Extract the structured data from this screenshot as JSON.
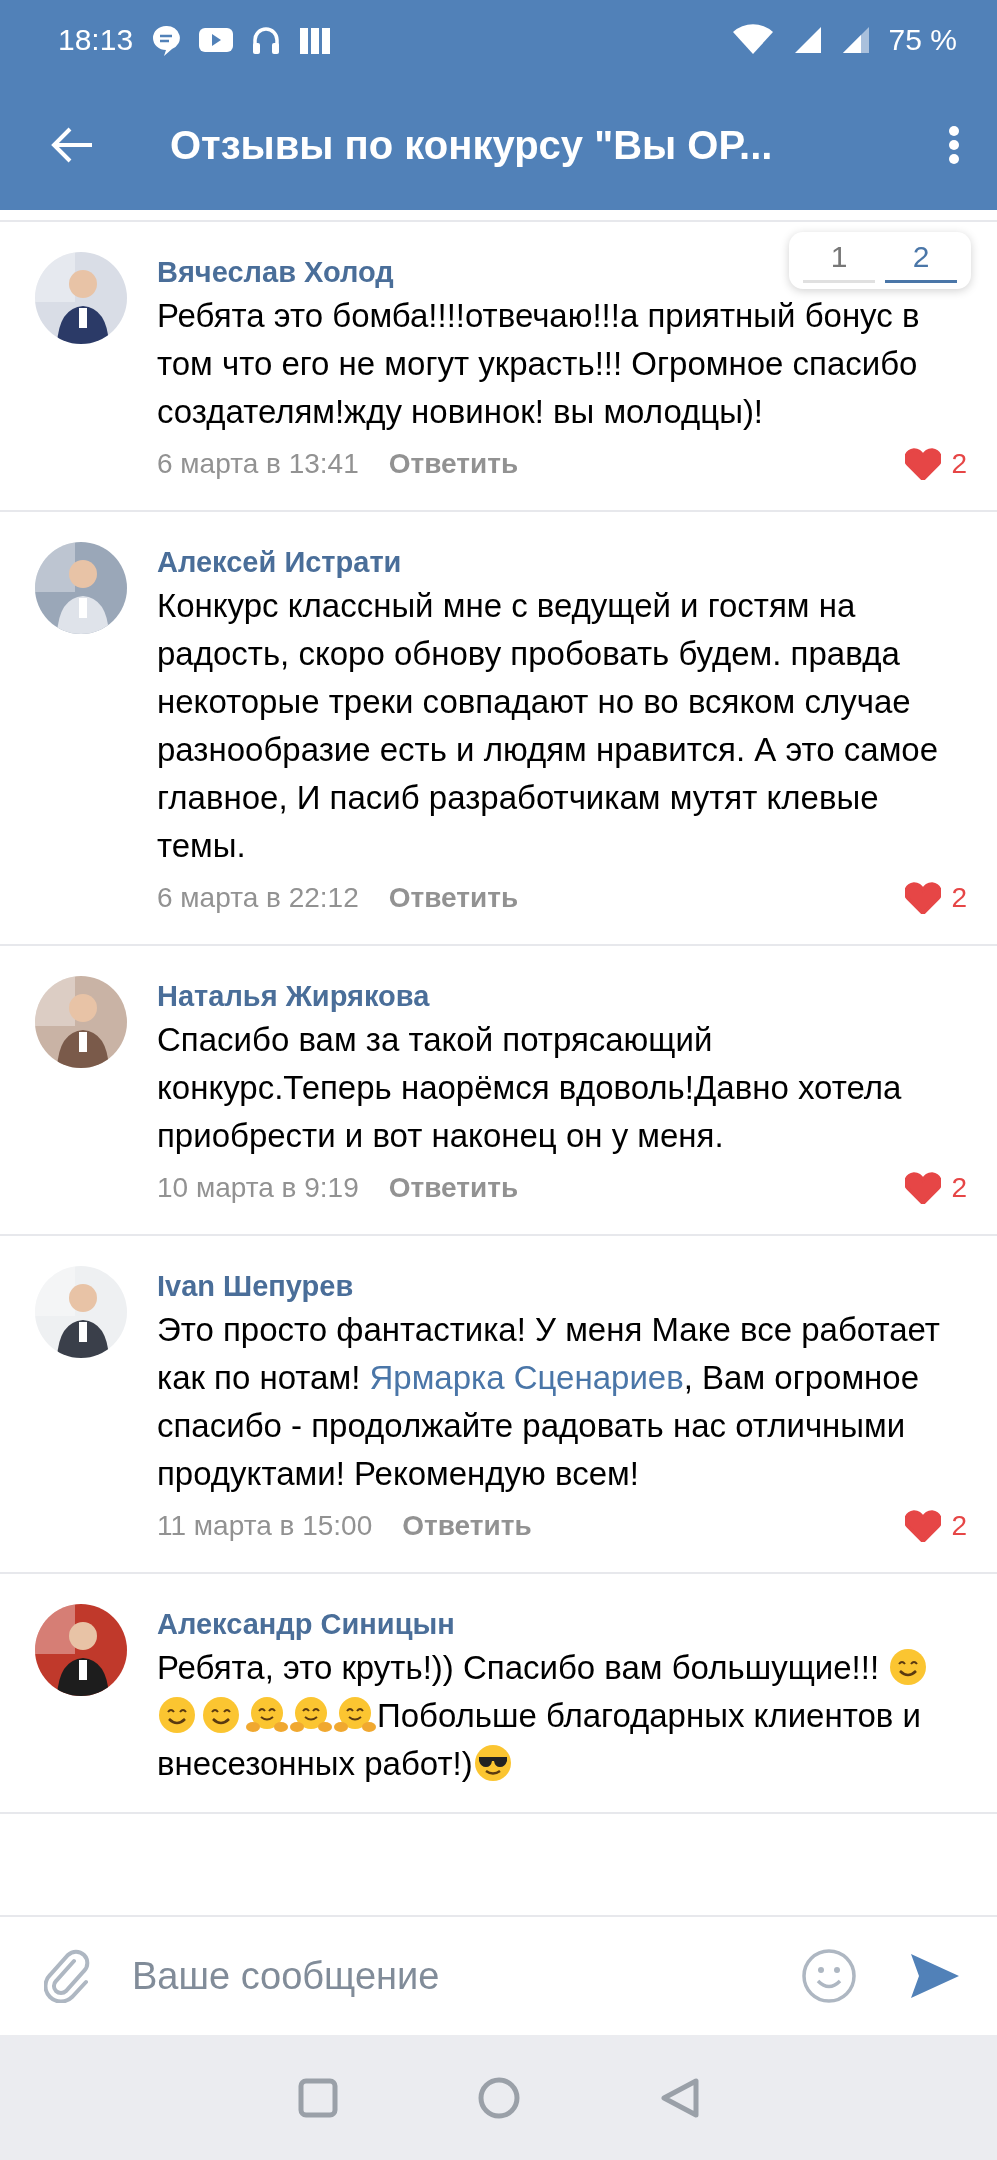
{
  "status_bar": {
    "time": "18:13",
    "battery": "75 %"
  },
  "header": {
    "title": "Отзывы по конкурсу \"Вы ОР..."
  },
  "pagination": [
    {
      "label": "1",
      "selected": false
    },
    {
      "label": "2",
      "selected": true
    }
  ],
  "comments": [
    {
      "author": "Вячеслав Холод",
      "body": [
        {
          "kind": "text",
          "text": "Ребята это бомба!!!!отвечаю!!!а приятный бонус в том что его не могут украсть!!! Огромное спасибо создателям!жду новинок! вы молодцы)!"
        }
      ],
      "date": "6 марта в 13:41",
      "reply": "Ответить",
      "likes": "2",
      "liked": true
    },
    {
      "author": "Алексей Истрати",
      "body": [
        {
          "kind": "text",
          "text": "Конкурс классный мне с ведущей и гостям на радость, скоро обнову пробовать будем. правда некоторые треки совпадают но во всяком случае разнообразие есть и людям нравится. А это самое главное, И пасиб разработчикам мутят клевые темы."
        }
      ],
      "date": "6 марта в 22:12",
      "reply": "Ответить",
      "likes": "2",
      "liked": true
    },
    {
      "author": "Наталья Жирякова",
      "body": [
        {
          "kind": "text",
          "text": "Спасибо вам за такой потрясающий конкурс.Теперь наорёмся вдоволь!Давно хотела приобрести и вот наконец он у меня."
        }
      ],
      "date": "10 марта в 9:19",
      "reply": "Ответить",
      "likes": "2",
      "liked": true
    },
    {
      "author": "Ivan Шепурев",
      "body": [
        {
          "kind": "text",
          "text": "Это просто фантастика! У меня Маке все работает как по нотам! "
        },
        {
          "kind": "link",
          "text": "Ярмарка Сценариев"
        },
        {
          "kind": "text",
          "text": ", Вам огромное спасибо - продолжайте радовать нас отличными продуктами! Рекомендую всем!"
        }
      ],
      "date": "11 марта в 15:00",
      "reply": "Ответить",
      "likes": "2",
      "liked": true
    },
    {
      "author": "Александр Синицын",
      "body": [
        {
          "kind": "text",
          "text": "Ребята, это круть!)) Спасибо вам большущие!!! "
        },
        {
          "kind": "smile"
        },
        {
          "kind": "smile"
        },
        {
          "kind": "smile"
        },
        {
          "kind": "hug"
        },
        {
          "kind": "hug"
        },
        {
          "kind": "hug"
        },
        {
          "kind": "text",
          "text": "Побольше благодарных клиентов и внесезонных работ!)"
        },
        {
          "kind": "cool"
        }
      ]
    }
  ],
  "composer": {
    "placeholder": "Ваше сообщение"
  }
}
